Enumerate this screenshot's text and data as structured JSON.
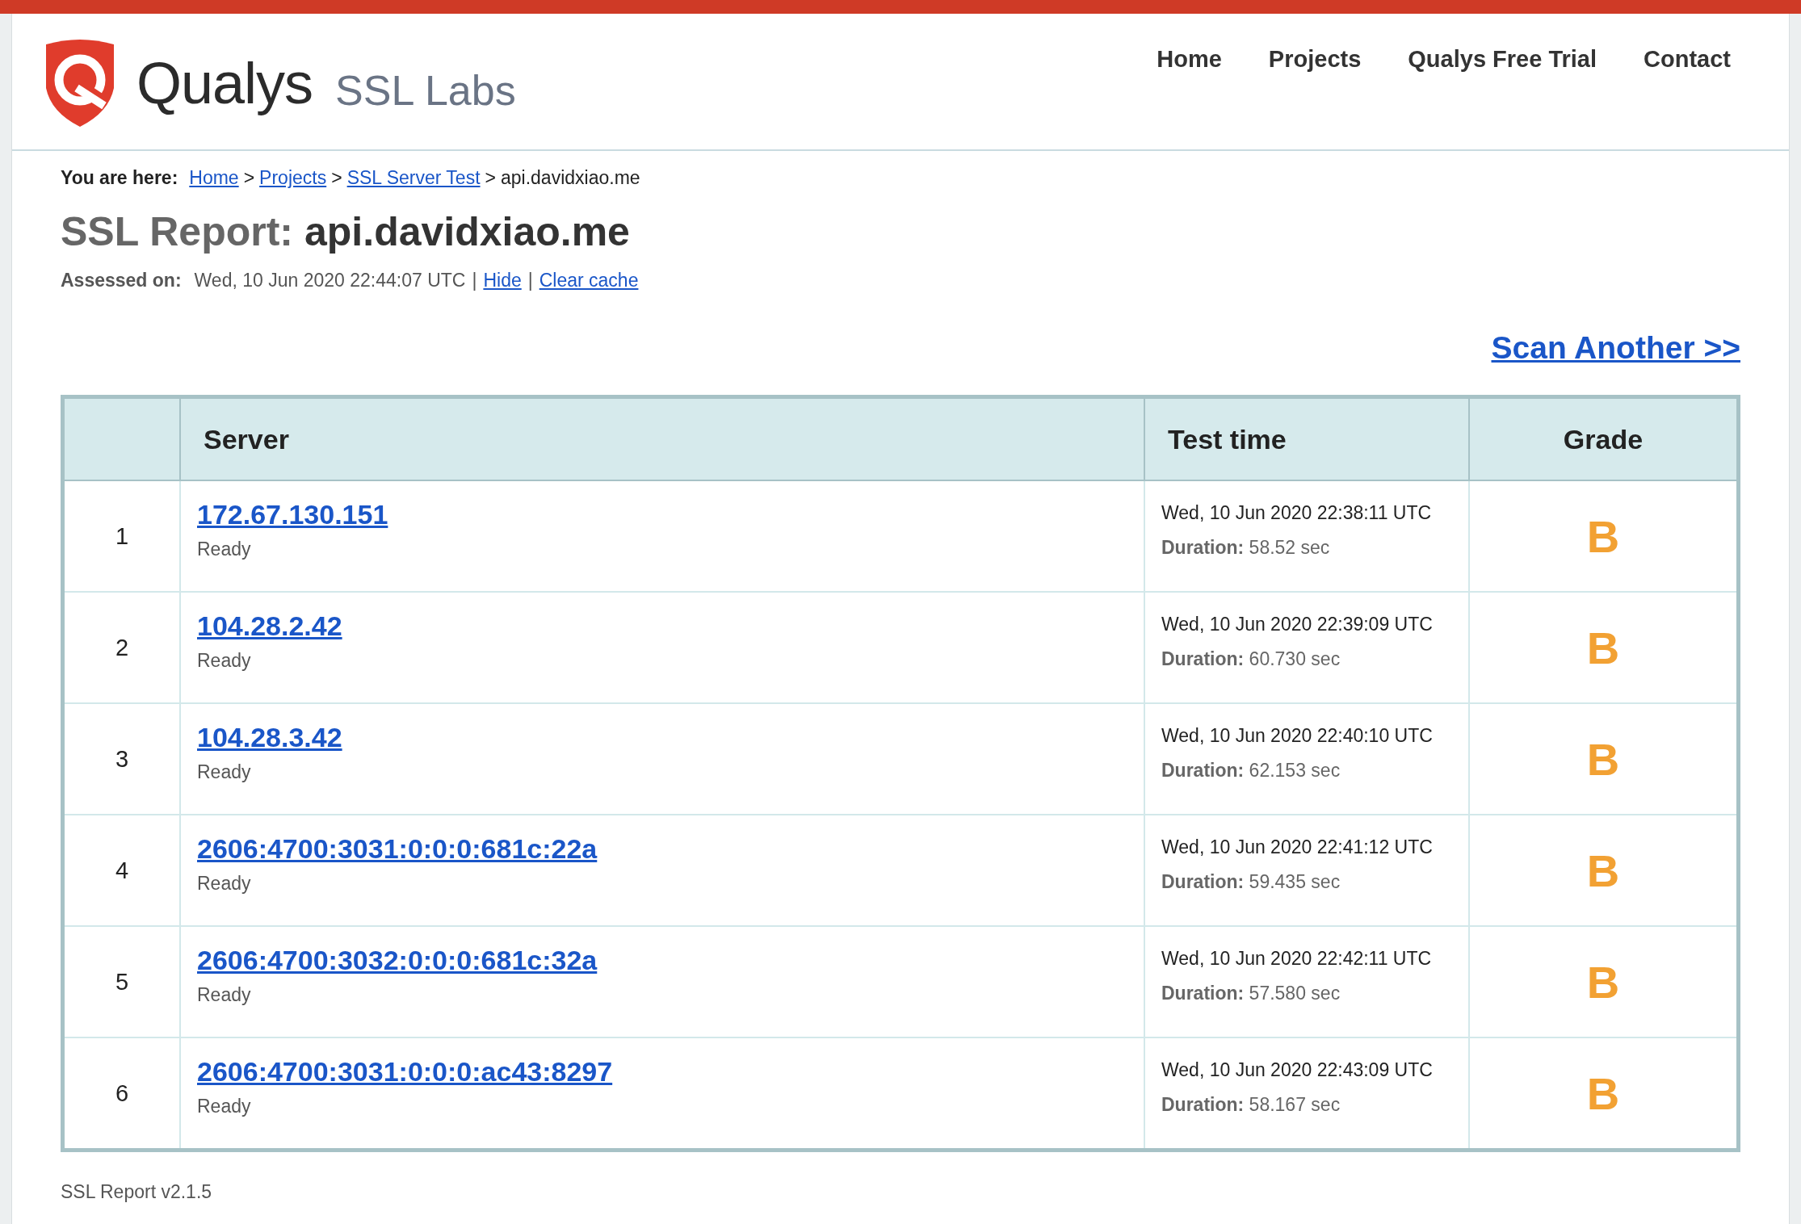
{
  "logo": {
    "brand": "Qualys",
    "product": "SSL Labs"
  },
  "nav": [
    "Home",
    "Projects",
    "Qualys Free Trial",
    "Contact"
  ],
  "breadcrumb": {
    "label": "You are here:",
    "links": [
      "Home",
      "Projects",
      "SSL Server Test"
    ],
    "current": "api.davidxiao.me",
    "separator": ">"
  },
  "title": {
    "prefix": "SSL Report:",
    "host": "api.davidxiao.me"
  },
  "assessed": {
    "label": "Assessed on:",
    "date": "Wed, 10 Jun 2020 22:44:07 UTC",
    "links": [
      "Hide",
      "Clear cache"
    ],
    "separator": "|"
  },
  "scan_another": "Scan Another >>",
  "table": {
    "columns": [
      "Server",
      "Test time",
      "Grade"
    ],
    "rows": [
      {
        "index": "1",
        "server": "172.67.130.151",
        "status": "Ready",
        "time": "Wed, 10 Jun 2020 22:38:11 UTC",
        "duration": "**Duration:** 58.52 sec",
        "grade": "B"
      },
      {
        "index": "2",
        "server": "104.28.2.42",
        "status": "Ready",
        "time": "Wed, 10 Jun 2020 22:39:09 UTC",
        "duration": "**Duration:** 60.730 sec",
        "grade": "B"
      },
      {
        "index": "3",
        "server": "104.28.3.42",
        "status": "Ready",
        "time": "Wed, 10 Jun 2020 22:40:10 UTC",
        "duration": "**Duration:** 62.153 sec",
        "grade": "B"
      },
      {
        "index": "4",
        "server": "2606:4700:3031:0:0:0:681c:22a",
        "status": "Ready",
        "time": "Wed, 10 Jun 2020 22:41:12 UTC",
        "duration": "**Duration:** 59.435 sec",
        "grade": "B"
      },
      {
        "index": "5",
        "server": "2606:4700:3032:0:0:0:681c:32a",
        "status": "Ready",
        "time": "Wed, 10 Jun 2020 22:42:11 UTC",
        "duration": "**Duration:** 57.580 sec",
        "grade": "B"
      },
      {
        "index": "6",
        "server": "2606:4700:3031:0:0:0:ac43:8297",
        "status": "Ready",
        "time": "Wed, 10 Jun 2020 22:43:09 UTC",
        "duration": "**Duration:** 58.167 sec",
        "grade": "B"
      }
    ]
  },
  "footer": "SSL Report v2.1.5"
}
